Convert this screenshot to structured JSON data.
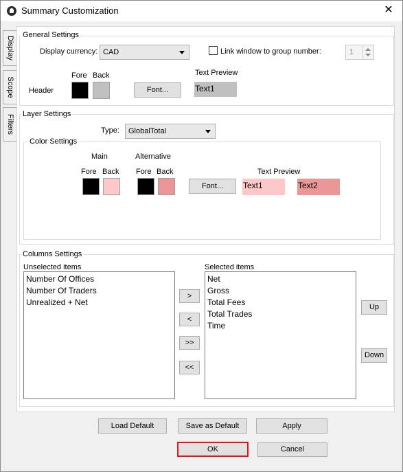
{
  "window": {
    "title": "Summary Customization",
    "close_glyph": "✕"
  },
  "tabs": [
    {
      "label": "Display",
      "active": true
    },
    {
      "label": "Scope",
      "active": false
    },
    {
      "label": "Filters",
      "active": false
    }
  ],
  "general": {
    "group_label": "General Settings",
    "display_currency_label": "Display currency:",
    "currency_value": "CAD",
    "link_window_label": "Link window to group number:",
    "link_checked": false,
    "group_number": "1",
    "fore_label": "Fore",
    "back_label": "Back",
    "header_label": "Header",
    "font_button": "Font...",
    "text_preview_label": "Text Preview",
    "preview_text": "Text1",
    "header_fore_color": "#000000",
    "header_back_color": "#c0c0c0"
  },
  "layer": {
    "group_label": "Layer Settings",
    "type_label": "Type:",
    "type_value": "GlobalTotal",
    "color_group_label": "Color Settings",
    "main_label": "Main",
    "alternative_label": "Alternative",
    "fore_label": "Fore",
    "back_label": "Back",
    "font_button": "Font...",
    "text_preview_label": "Text Preview",
    "preview_main": "Text1",
    "preview_alt": "Text2",
    "main_fore_color": "#000000",
    "main_back_color": "#ffc8c8",
    "alt_fore_color": "#000000",
    "alt_back_color": "#eb9696"
  },
  "columns": {
    "group_label": "Columns Settings",
    "unselected_label": "Unselected items",
    "selected_label": "Selected items",
    "unselected": [
      "Number Of Offices",
      "Number Of Traders",
      "Unrealized + Net"
    ],
    "selected": [
      "Net",
      "Gross",
      "Total Fees",
      "Total Trades",
      "Time"
    ],
    "move_right": ">",
    "move_left": "<",
    "move_all_right": ">>",
    "move_all_left": "<<",
    "up": "Up",
    "down": "Down"
  },
  "footer": {
    "load_default": "Load Default",
    "save_default": "Save as Default",
    "apply": "Apply",
    "ok": "OK",
    "cancel": "Cancel"
  }
}
